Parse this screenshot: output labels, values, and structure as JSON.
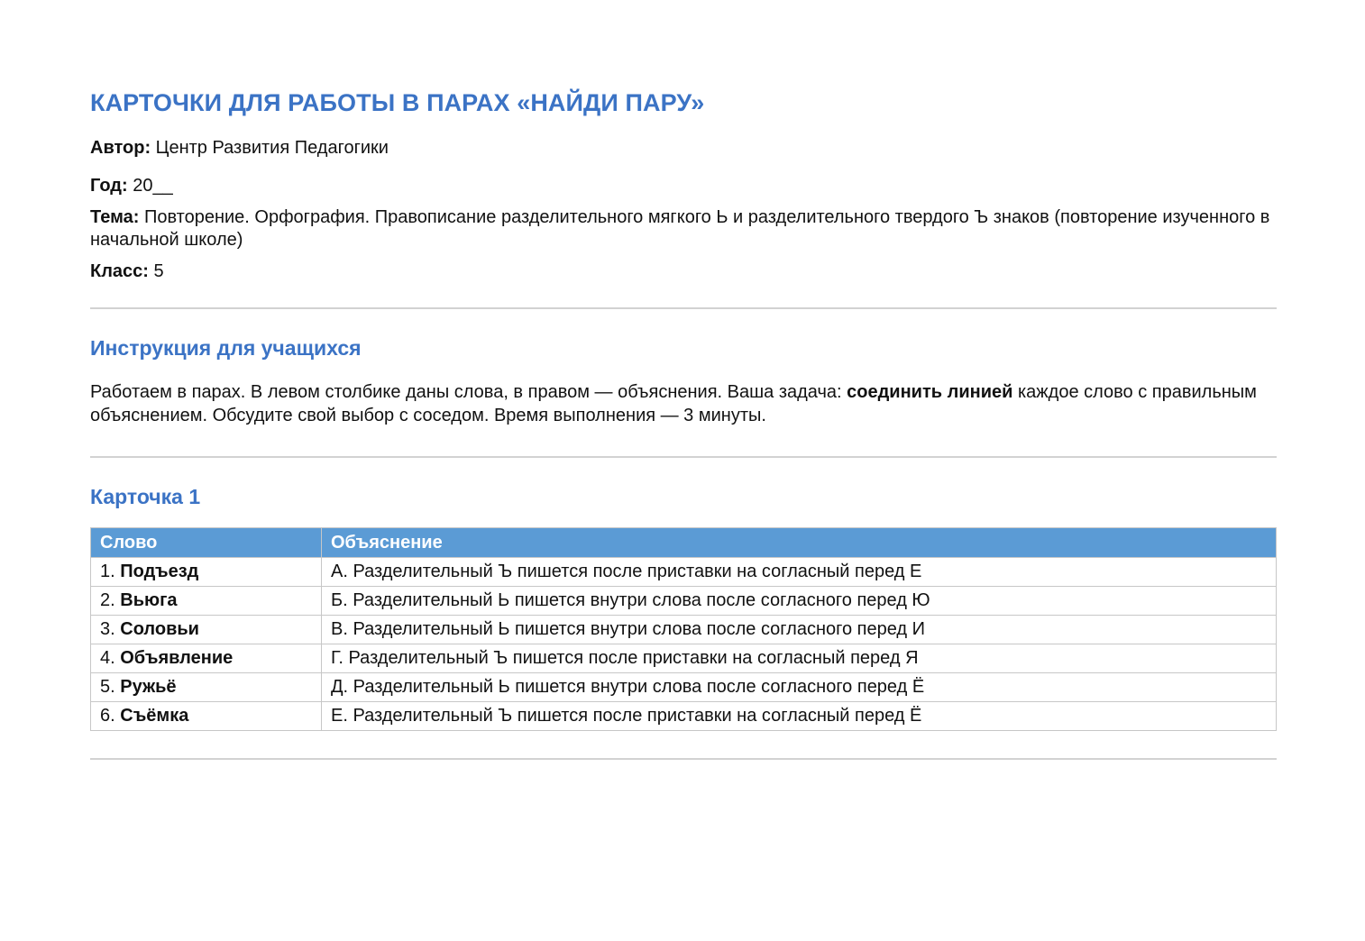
{
  "title": "КАРТОЧКИ ДЛЯ РАБОТЫ В ПАРАХ «НАЙДИ ПАРУ»",
  "meta": {
    "author_label": "Автор:",
    "author": "Центр Развития Педагогики",
    "year_label": "Год:",
    "year": "20__",
    "topic_label": "Тема:",
    "topic": "Повторение. Орфография. Правописание разделительного мягкого Ь и разделительного твердого Ъ знаков (повторение изученного в начальной школе)",
    "class_label": "Класс:",
    "class": "5"
  },
  "instructions": {
    "heading": "Инструкция для учащихся",
    "text_before": "Работаем в парах. В левом столбике даны слова, в правом — объяснения. Ваша задача: ",
    "text_bold": "соединить линией",
    "text_after": " каждое слово с правильным объяснением. Обсудите свой выбор с соседом. Время выполнения — 3 минуты."
  },
  "card": {
    "heading": "Карточка 1",
    "columns": [
      "Слово",
      "Объяснение"
    ],
    "rows": [
      {
        "num": "1.",
        "word": "Подъезд",
        "explanation": "А. Разделительный Ъ пишется после приставки на согласный перед Е"
      },
      {
        "num": "2.",
        "word": "Вьюга",
        "explanation": "Б. Разделительный Ь пишется внутри слова после согласного перед Ю"
      },
      {
        "num": "3.",
        "word": "Соловьи",
        "explanation": "В. Разделительный Ь пишется внутри слова после согласного перед И"
      },
      {
        "num": "4.",
        "word": "Объявление",
        "explanation": "Г. Разделительный Ъ пишется после приставки на согласный перед Я"
      },
      {
        "num": "5.",
        "word": "Ружьё",
        "explanation": "Д. Разделительный Ь пишется внутри слова после согласного перед Ё"
      },
      {
        "num": "6.",
        "word": "Съёмка",
        "explanation": "Е. Разделительный Ъ пишется после приставки на согласный перед Ё"
      }
    ]
  },
  "colors": {
    "heading_blue": "#3b73c5",
    "table_header_bg": "#5b9bd5"
  }
}
